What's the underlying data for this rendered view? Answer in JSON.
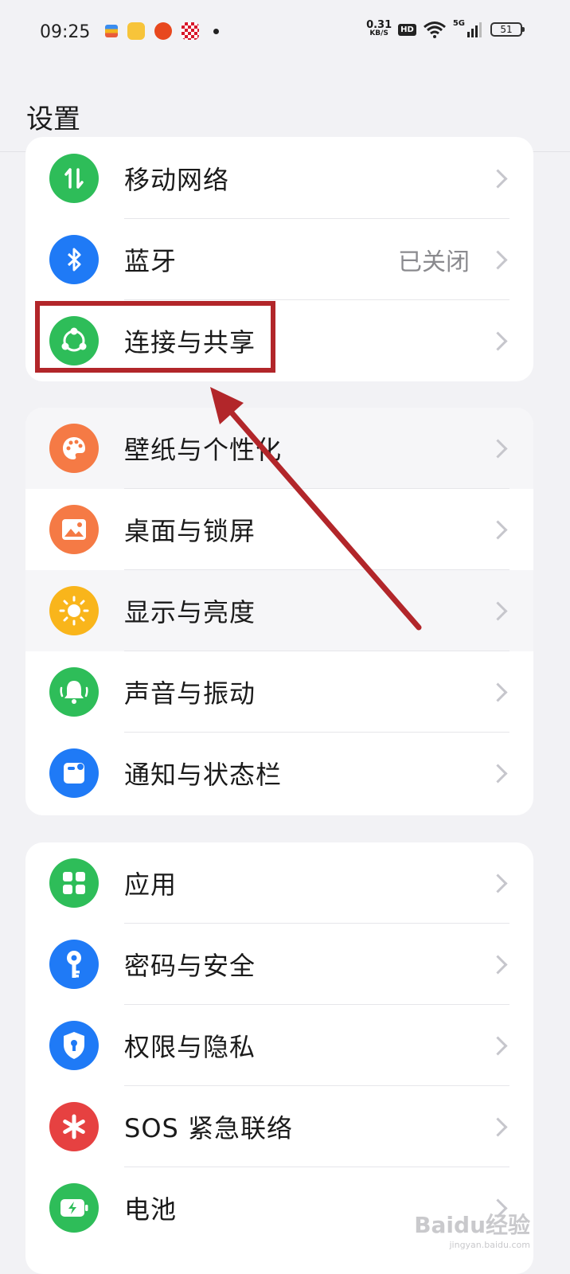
{
  "status_bar": {
    "time": "09:25",
    "net_speed_value": "0.31",
    "net_speed_unit": "KB/S",
    "hd_label": "HD",
    "network_label": "5G",
    "battery_level": "51",
    "notification_apps": [
      "wallet-app",
      "coupon-app",
      "shopping-app",
      "checker-app"
    ]
  },
  "header": {
    "title": "设置"
  },
  "groups": [
    {
      "items": [
        {
          "label": "移动网络",
          "icon": "mobile-network-icon",
          "color": "#2ebd59"
        },
        {
          "label": "蓝牙",
          "icon": "bluetooth-icon",
          "color": "#1f7af6",
          "value": "已关闭"
        },
        {
          "label": "连接与共享",
          "icon": "connection-share-icon",
          "color": "#2ebd59"
        }
      ]
    },
    {
      "items": [
        {
          "label": "壁纸与个性化",
          "icon": "palette-icon",
          "color": "#f57a45"
        },
        {
          "label": "桌面与锁屏",
          "icon": "picture-icon",
          "color": "#f57a45"
        },
        {
          "label": "显示与亮度",
          "icon": "sun-icon",
          "color": "#f9b51b"
        },
        {
          "label": "声音与振动",
          "icon": "bell-icon",
          "color": "#2ebd59"
        },
        {
          "label": "通知与状态栏",
          "icon": "notification-icon",
          "color": "#1f7af6"
        }
      ]
    },
    {
      "items": [
        {
          "label": "应用",
          "icon": "apps-grid-icon",
          "color": "#2ebd59"
        },
        {
          "label": "密码与安全",
          "icon": "key-icon",
          "color": "#1f7af6"
        },
        {
          "label": "权限与隐私",
          "icon": "shield-icon",
          "color": "#1f7af6"
        },
        {
          "label": "SOS 紧急联络",
          "icon": "sos-icon",
          "color": "#e64141"
        },
        {
          "label": "电池",
          "icon": "battery-icon",
          "color": "#2ebd59"
        }
      ]
    }
  ],
  "annotation_color": "#b2262a",
  "watermark": {
    "brand": "Baidu经验",
    "url": "jingyan.baidu.com"
  }
}
